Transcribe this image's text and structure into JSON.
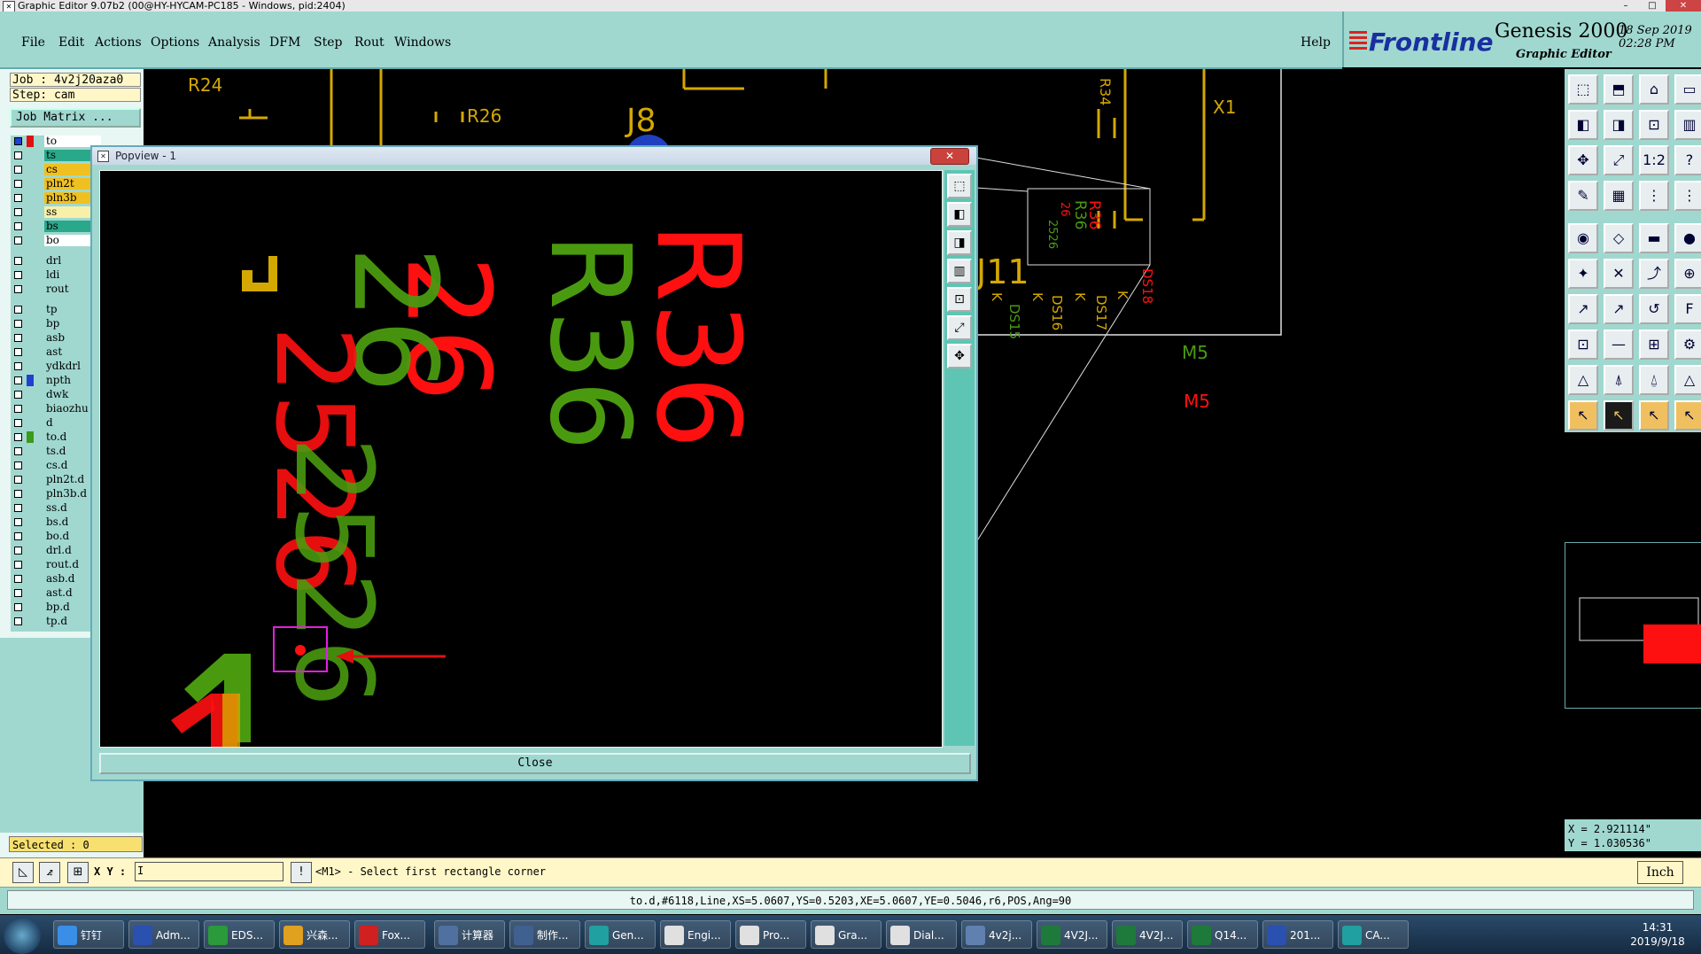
{
  "window": {
    "title": "Graphic Editor 9.07b2 (00@HY-HYCAM-PC185 - Windows, pid:2404)",
    "controls": {
      "min": "–",
      "max": "□",
      "close": "✕"
    }
  },
  "menu": {
    "items": [
      "File",
      "Edit",
      "Actions",
      "Options",
      "Analysis",
      "DFM",
      "Step",
      "Rout",
      "Windows"
    ],
    "help": "Help"
  },
  "brand": {
    "logo": "Frontline",
    "product": "Genesis 2000",
    "subtitle": "Graphic Editor",
    "date": "18 Sep 2019",
    "time": "02:28 PM"
  },
  "info": {
    "job": "Job : 4v2j20aza0",
    "step": "Step: cam",
    "job_matrix": "Job Matrix ..."
  },
  "layers": [
    {
      "name": "to",
      "color": "#ffffff",
      "swatch": "#e01010",
      "marker": "#2040d0"
    },
    {
      "name": "ts",
      "color": "#2aa88a",
      "swatch": "#a0d8d0"
    },
    {
      "name": "cs",
      "color": "#f0c020",
      "swatch": "#a0d8d0"
    },
    {
      "name": "pln2t",
      "color": "#f0c020",
      "swatch": "#a0d8d0"
    },
    {
      "name": "pln3b",
      "color": "#f0c020",
      "swatch": "#a0d8d0"
    },
    {
      "name": "ss",
      "color": "#f8f0a8",
      "swatch": "#a0d8d0"
    },
    {
      "name": "bs",
      "color": "#2aa88a",
      "swatch": "#a0d8d0"
    },
    {
      "name": "bo",
      "color": "#ffffff",
      "swatch": "#a0d8d0"
    },
    {
      "name": "drl",
      "color": "#a0d8d0",
      "swatch": "#a0d8d0"
    },
    {
      "name": "ldi",
      "color": "#a0d8d0",
      "swatch": "#a0d8d0"
    },
    {
      "name": "rout",
      "color": "#a0d8d0",
      "swatch": "#a0d8d0"
    },
    {
      "name": "tp",
      "color": "#a0d8d0",
      "swatch": "#a0d8d0"
    },
    {
      "name": "bp",
      "color": "#a0d8d0",
      "swatch": "#a0d8d0"
    },
    {
      "name": "asb",
      "color": "#a0d8d0",
      "swatch": "#a0d8d0"
    },
    {
      "name": "ast",
      "color": "#a0d8d0",
      "swatch": "#a0d8d0"
    },
    {
      "name": "ydkdrl",
      "color": "#a0d8d0",
      "swatch": "#a0d8d0"
    },
    {
      "name": "npth",
      "color": "#a0d8d0",
      "swatch": "#2040d0"
    },
    {
      "name": "dwk",
      "color": "#a0d8d0",
      "swatch": "#a0d8d0"
    },
    {
      "name": "biaozhu",
      "color": "#a0d8d0",
      "swatch": "#a0d8d0"
    },
    {
      "name": "d",
      "color": "#a0d8d0",
      "swatch": "#a0d8d0"
    },
    {
      "name": "to.d",
      "color": "#a0d8d0",
      "swatch": "#3a9a1a"
    },
    {
      "name": "ts.d",
      "color": "#a0d8d0",
      "swatch": "#a0d8d0"
    },
    {
      "name": "cs.d",
      "color": "#a0d8d0",
      "swatch": "#a0d8d0"
    },
    {
      "name": "pln2t.d",
      "color": "#a0d8d0",
      "swatch": "#a0d8d0"
    },
    {
      "name": "pln3b.d",
      "color": "#a0d8d0",
      "swatch": "#a0d8d0"
    },
    {
      "name": "ss.d",
      "color": "#a0d8d0",
      "swatch": "#a0d8d0"
    },
    {
      "name": "bs.d",
      "color": "#a0d8d0",
      "swatch": "#a0d8d0"
    },
    {
      "name": "bo.d",
      "color": "#a0d8d0",
      "swatch": "#a0d8d0"
    },
    {
      "name": "drl.d",
      "color": "#a0d8d0",
      "swatch": "#a0d8d0"
    },
    {
      "name": "rout.d",
      "color": "#a0d8d0",
      "swatch": "#a0d8d0"
    },
    {
      "name": "asb.d",
      "color": "#a0d8d0",
      "swatch": "#a0d8d0"
    },
    {
      "name": "ast.d",
      "color": "#a0d8d0",
      "swatch": "#a0d8d0"
    },
    {
      "name": "bp.d",
      "color": "#a0d8d0",
      "swatch": "#a0d8d0"
    },
    {
      "name": "tp.d",
      "color": "#a0d8d0",
      "swatch": "#a0d8d0"
    }
  ],
  "selected": "Selected : 0",
  "canvas": {
    "labels": {
      "r24": "R24",
      "r26": "R26",
      "j8": "J8",
      "x1": "X1",
      "r34": "R34",
      "j11": "J11",
      "m5_green": "M5",
      "m5_red": "M5",
      "ds15": "DS15",
      "ds16": "DS16",
      "ds17": "DS17",
      "ds18": "DS18",
      "k": "K",
      "mini_r36_red": "R36",
      "mini_r36_green": "R36",
      "mini_26": "26",
      "mini_2526": "2526"
    },
    "colors": {
      "red": "#ff1010",
      "green": "#4a9a10",
      "yellow": "#d4a800",
      "outline": "#e0e0e0"
    }
  },
  "popview": {
    "title": "Popview - 1",
    "close_x": "✕",
    "close_button": "Close",
    "texts": {
      "r36_red": "R36",
      "r36_green": "R36",
      "n26_red": "26",
      "n26_green": "26",
      "n2526": "2526",
      "n1": "1",
      "n1_red": "1"
    },
    "highlight_color": "#e020e0",
    "arrow_color": "#e01010"
  },
  "right_toolbar": {
    "icons": [
      "zoom-home",
      "zoom-page",
      "home",
      "frame",
      "zoom-in",
      "zoom-out",
      "zoom-fit",
      "split",
      "pan",
      "scale",
      "one-to-one",
      "help",
      "wizard",
      "grid",
      "layers-a",
      "layers-b",
      "select-point",
      "select-area",
      "measure",
      "snap-point",
      "node-edit",
      "cross",
      "link",
      "feature-b",
      "draw-line",
      "draw-line-alt",
      "arc",
      "text-f",
      "pad-add",
      "line-add",
      "surface",
      "shape",
      "triangle-a",
      "triangle-b",
      "triangle-c",
      "triangle-d",
      "pointer",
      "pointer-active",
      "pointer-c",
      "pointer-d"
    ],
    "glyphs": [
      "⬚",
      "⬒",
      "⌂",
      "▭",
      "◧",
      "◨",
      "⊡",
      "▥",
      "✥",
      "⤢",
      "1:2",
      "?",
      "✎",
      "▦",
      "⋮",
      "⋮",
      "◉",
      "◇",
      "▬",
      "●",
      "✦",
      "✕",
      "⤴",
      "⊕",
      "↗",
      "↗",
      "↺",
      "F",
      "⊡",
      "—",
      "⊞",
      "⚙",
      "△",
      "⍋",
      "⍙",
      "△",
      "↖",
      "↖",
      "↖",
      "↖"
    ]
  },
  "coords": {
    "x": "X = 2.921114\"",
    "y": "Y = 1.030536\""
  },
  "command": {
    "xy_label": "X Y :",
    "xy_value": "",
    "prompt": "<M1> - Select first rectangle corner",
    "units": "Inch",
    "cursor": "I"
  },
  "status": "to.d,#6118,Line,XS=5.0607,YS=0.5203,XE=5.0607,YE=0.5046,r6,POS,Ang=90",
  "taskbar": {
    "items": [
      {
        "label": "钉钉",
        "color": "#3a8ee8"
      },
      {
        "label": "Adm...",
        "color": "#2a50b0"
      },
      {
        "label": "EDS...",
        "color": "#2a9a3a"
      },
      {
        "label": "兴森...",
        "color": "#e0a020"
      },
      {
        "label": "Fox...",
        "color": "#d02020"
      },
      {
        "label": "计算器",
        "color": "#5070a0"
      },
      {
        "label": "制作...",
        "color": "#406090"
      },
      {
        "label": "Gen...",
        "color": "#20a0a0"
      },
      {
        "label": "Engi...",
        "color": "#e0e0e0"
      },
      {
        "label": "Pro...",
        "color": "#e0e0e0"
      },
      {
        "label": "Gra...",
        "color": "#e0e0e0"
      },
      {
        "label": "Dial...",
        "color": "#e0e0e0"
      },
      {
        "label": "4v2j...",
        "color": "#6080b0"
      },
      {
        "label": "4V2J...",
        "color": "#1e7a3a"
      },
      {
        "label": "4V2J...",
        "color": "#1e7a3a"
      },
      {
        "label": "Q14...",
        "color": "#1e7a3a"
      },
      {
        "label": "201...",
        "color": "#2a50b0"
      },
      {
        "label": "CA...",
        "color": "#20a0a0"
      }
    ],
    "time": "14:31",
    "date": "2019/9/18"
  }
}
